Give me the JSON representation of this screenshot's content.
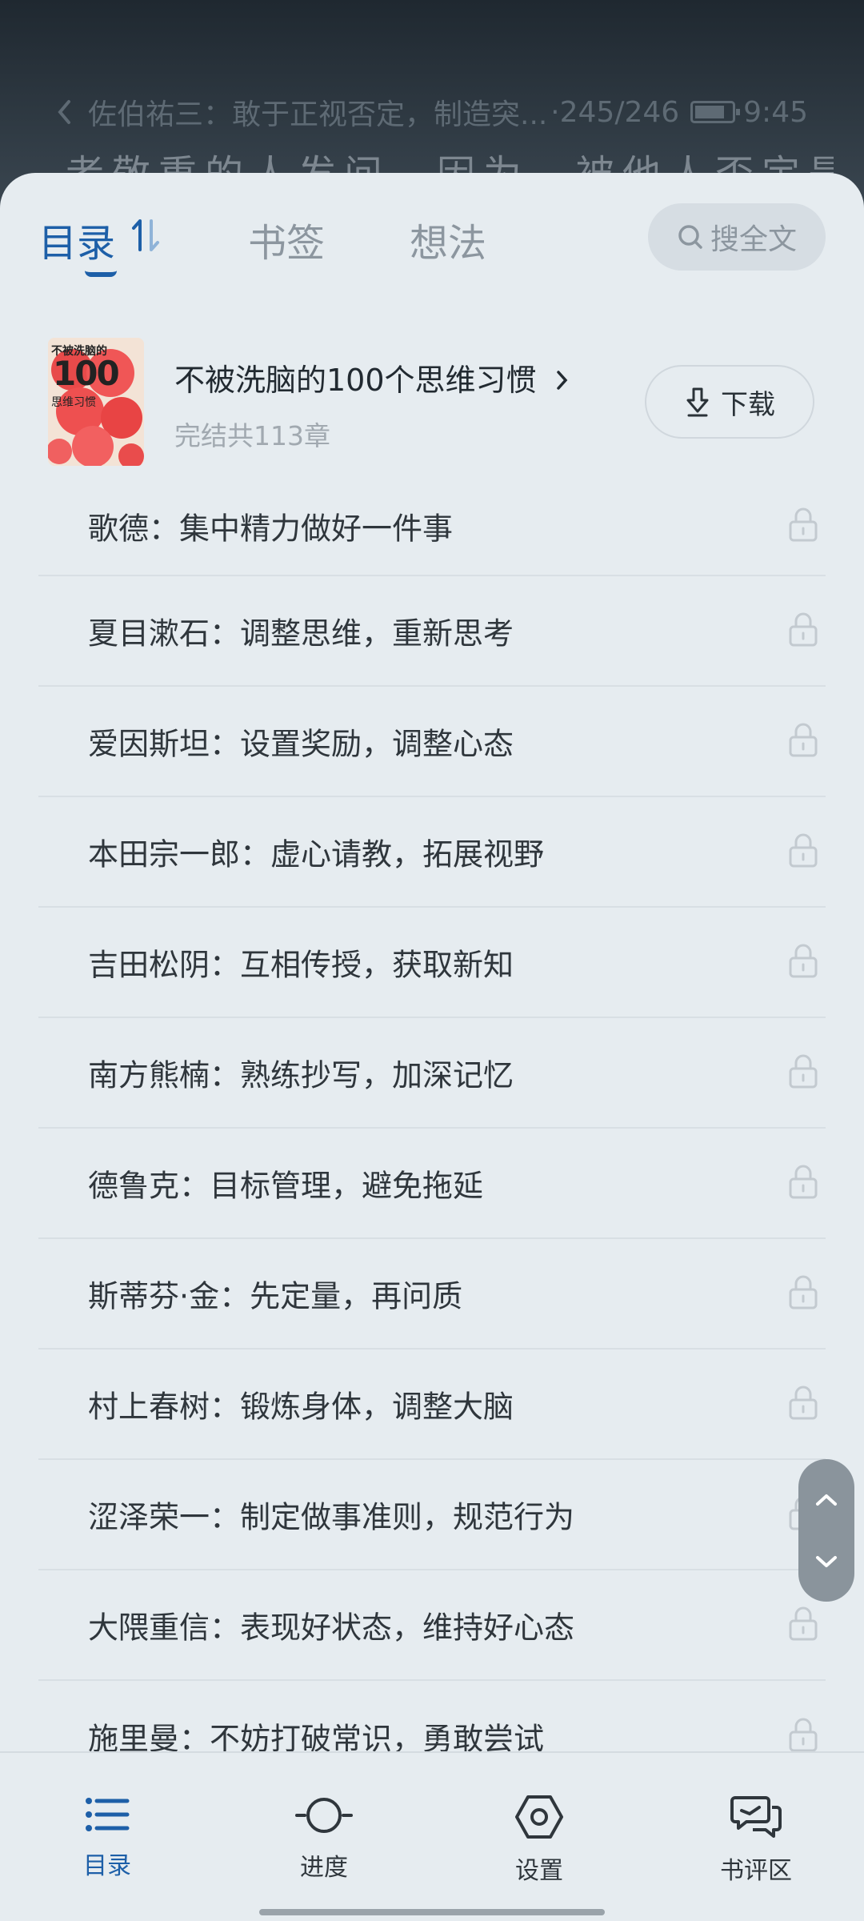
{
  "reader": {
    "title": "佐伯祐三：敢于正视否定，制造突...",
    "progress": "·245/246",
    "time": "9:45",
    "text": "者敬重的人发问，因为，被他人否定是"
  },
  "tabs": {
    "toc": "目录",
    "bookmark": "书签",
    "notes": "想法",
    "search": "搜全文"
  },
  "book": {
    "title": "不被洗脑的100个思维习惯",
    "meta": "完结共113章",
    "download": "下载",
    "cover_text_top": "不被洗脑的",
    "cover_text_num": "100",
    "cover_text_bottom": "思维习惯"
  },
  "chapters": [
    "歌德：集中精力做好一件事",
    "夏目漱石：调整思维，重新思考",
    "爱因斯坦：设置奖励，调整心态",
    "本田宗一郎：虚心请教，拓展视野",
    "吉田松阴：互相传授，获取新知",
    "南方熊楠：熟练抄写，加深记忆",
    "德鲁克：目标管理，避免拖延",
    "斯蒂芬·金：先定量，再问质",
    "村上春树：锻炼身体，调整大脑",
    "涩泽荣一：制定做事准则，规范行为",
    "大隈重信：表现好状态，维持好心态",
    "施里曼：不妨打破常识，勇敢尝试"
  ],
  "nav": {
    "toc": "目录",
    "progress": "进度",
    "settings": "设置",
    "reviews": "书评区"
  },
  "colors": {
    "accent": "#1d5fa8",
    "sheet_bg": "#e6ecf0",
    "text": "#2f363c",
    "muted": "#8c969f"
  }
}
